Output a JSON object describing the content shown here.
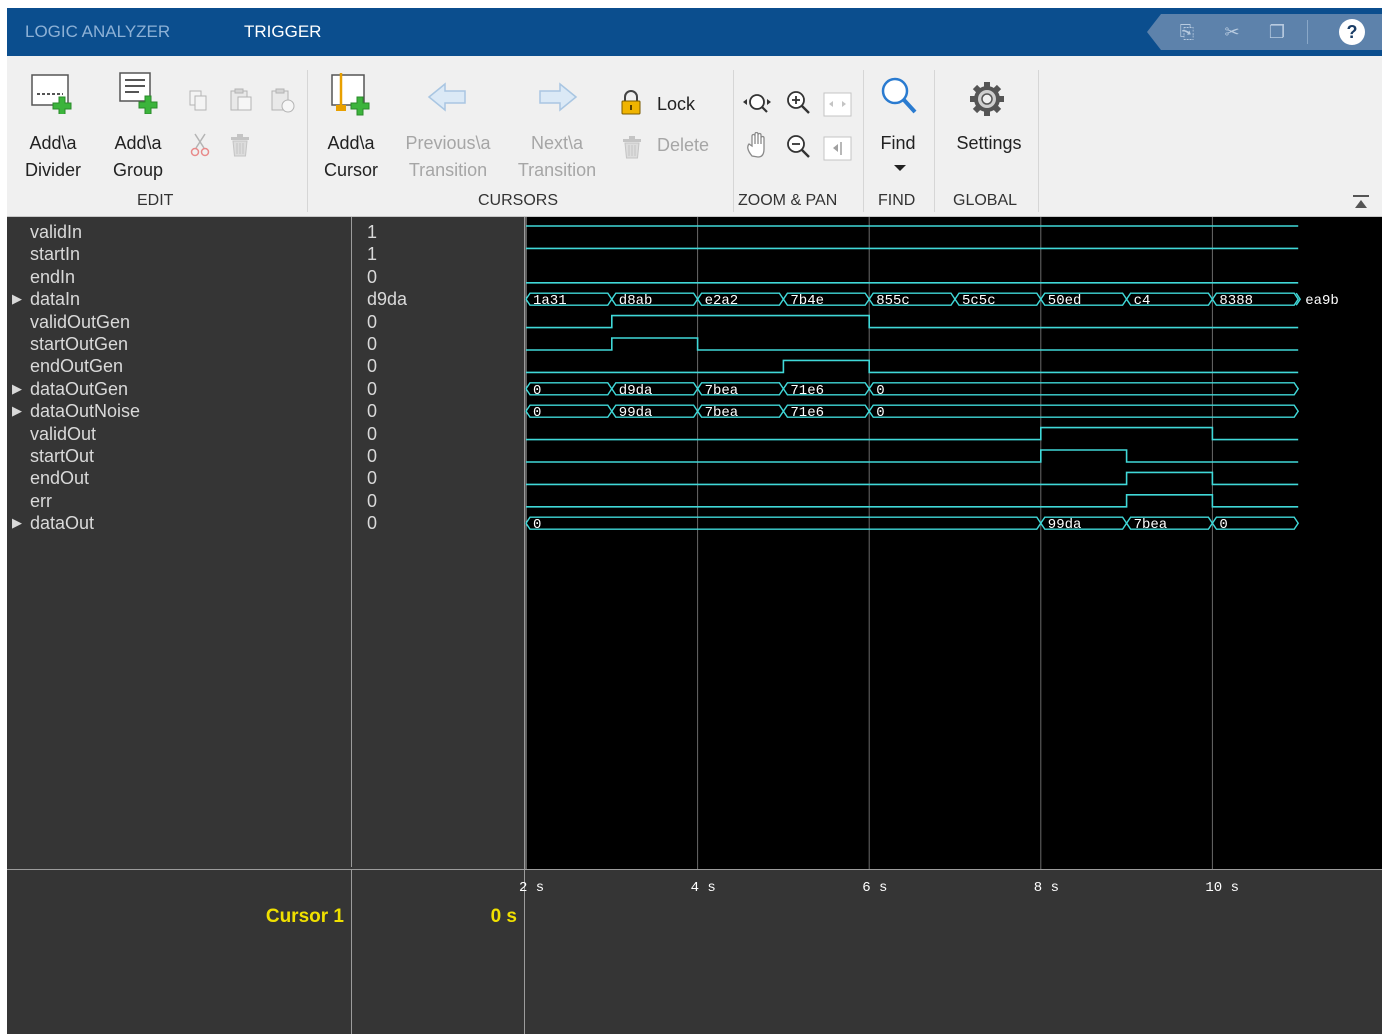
{
  "tabs": [
    {
      "label": "LOGIC ANALYZER",
      "active": false
    },
    {
      "label": "TRIGGER",
      "active": true
    }
  ],
  "quick_access": {
    "help_label": "?"
  },
  "toolstrip": {
    "edit": {
      "section_label": "EDIT",
      "add_divider": {
        "line1": "Add\\a",
        "line2": "Divider"
      },
      "add_group": {
        "line1": "Add\\a",
        "line2": "Group"
      }
    },
    "cursors": {
      "section_label": "CURSORS",
      "add_cursor": {
        "line1": "Add\\a",
        "line2": "Cursor"
      },
      "previous_transition": {
        "line1": "Previous\\a",
        "line2": "Transition"
      },
      "next_transition": {
        "line1": "Next\\a",
        "line2": "Transition"
      },
      "lock_label": "Lock",
      "delete_label": "Delete"
    },
    "zoom_pan": {
      "section_label": "ZOOM & PAN"
    },
    "find": {
      "section_label": "FIND",
      "find_label": "Find"
    },
    "global": {
      "section_label": "GLOBAL",
      "settings_label": "Settings"
    }
  },
  "signals": [
    {
      "name": "validIn",
      "value": "1",
      "expandable": false
    },
    {
      "name": "startIn",
      "value": "1",
      "expandable": false
    },
    {
      "name": "endIn",
      "value": "0",
      "expandable": false
    },
    {
      "name": "dataIn",
      "value": "d9da",
      "expandable": true
    },
    {
      "name": "validOutGen",
      "value": "0",
      "expandable": false
    },
    {
      "name": "startOutGen",
      "value": "0",
      "expandable": false
    },
    {
      "name": "endOutGen",
      "value": "0",
      "expandable": false
    },
    {
      "name": "dataOutGen",
      "value": "0",
      "expandable": true
    },
    {
      "name": "dataOutNoise",
      "value": "0",
      "expandable": true
    },
    {
      "name": "validOut",
      "value": "0",
      "expandable": false
    },
    {
      "name": "startOut",
      "value": "0",
      "expandable": false
    },
    {
      "name": "endOut",
      "value": "0",
      "expandable": false
    },
    {
      "name": "err",
      "value": "0",
      "expandable": false
    },
    {
      "name": "dataOut",
      "value": "0",
      "expandable": true
    }
  ],
  "waveforms": {
    "time_range": [
      2,
      11
    ],
    "digital": {
      "validIn": [
        [
          2,
          1
        ]
      ],
      "startIn": [
        [
          2,
          1
        ]
      ],
      "endIn": [
        [
          2,
          0
        ]
      ],
      "validOutGen": [
        [
          2,
          0
        ],
        [
          3,
          1
        ],
        [
          6,
          0
        ]
      ],
      "startOutGen": [
        [
          2,
          0
        ],
        [
          3,
          1
        ],
        [
          4,
          0
        ]
      ],
      "endOutGen": [
        [
          2,
          0
        ],
        [
          5,
          1
        ],
        [
          6,
          0
        ]
      ],
      "validOut": [
        [
          2,
          0
        ],
        [
          8,
          1
        ],
        [
          10,
          0
        ]
      ],
      "startOut": [
        [
          2,
          0
        ],
        [
          8,
          1
        ],
        [
          9,
          0
        ]
      ],
      "endOut": [
        [
          2,
          0
        ],
        [
          9,
          1
        ],
        [
          10,
          0
        ]
      ],
      "err": [
        [
          2,
          0
        ],
        [
          9,
          1
        ],
        [
          10,
          0
        ]
      ]
    },
    "bus": {
      "dataIn": [
        [
          2,
          "1a31"
        ],
        [
          3,
          "d8ab"
        ],
        [
          4,
          "e2a2"
        ],
        [
          5,
          "7b4e"
        ],
        [
          6,
          "855c"
        ],
        [
          7,
          "5c5c"
        ],
        [
          8,
          "50ed"
        ],
        [
          9,
          "c4"
        ],
        [
          10,
          "8388"
        ],
        [
          11,
          "ea9b"
        ]
      ],
      "dataOutGen": [
        [
          2,
          "0"
        ],
        [
          3,
          "d9da"
        ],
        [
          4,
          "7bea"
        ],
        [
          5,
          "71e6"
        ],
        [
          6,
          "0"
        ]
      ],
      "dataOutNoise": [
        [
          2,
          "0"
        ],
        [
          3,
          "99da"
        ],
        [
          4,
          "7bea"
        ],
        [
          5,
          "71e6"
        ],
        [
          6,
          "0"
        ]
      ],
      "dataOut": [
        [
          2,
          "0"
        ],
        [
          8,
          "99da"
        ],
        [
          9,
          "7bea"
        ],
        [
          10,
          "0"
        ]
      ]
    }
  },
  "time_axis": {
    "ticks": [
      {
        "t": 2,
        "label": "2 s"
      },
      {
        "t": 4,
        "label": "4 s"
      },
      {
        "t": 6,
        "label": "6 s"
      },
      {
        "t": 8,
        "label": "8 s"
      },
      {
        "t": 10,
        "label": "10 s"
      }
    ]
  },
  "cursor": {
    "name": "Cursor 1",
    "value": "0 s",
    "time": 2
  },
  "colors": {
    "trace": "#40d8d8",
    "cursor_text": "#f0e000",
    "tabbar": "#0b4e8e"
  }
}
